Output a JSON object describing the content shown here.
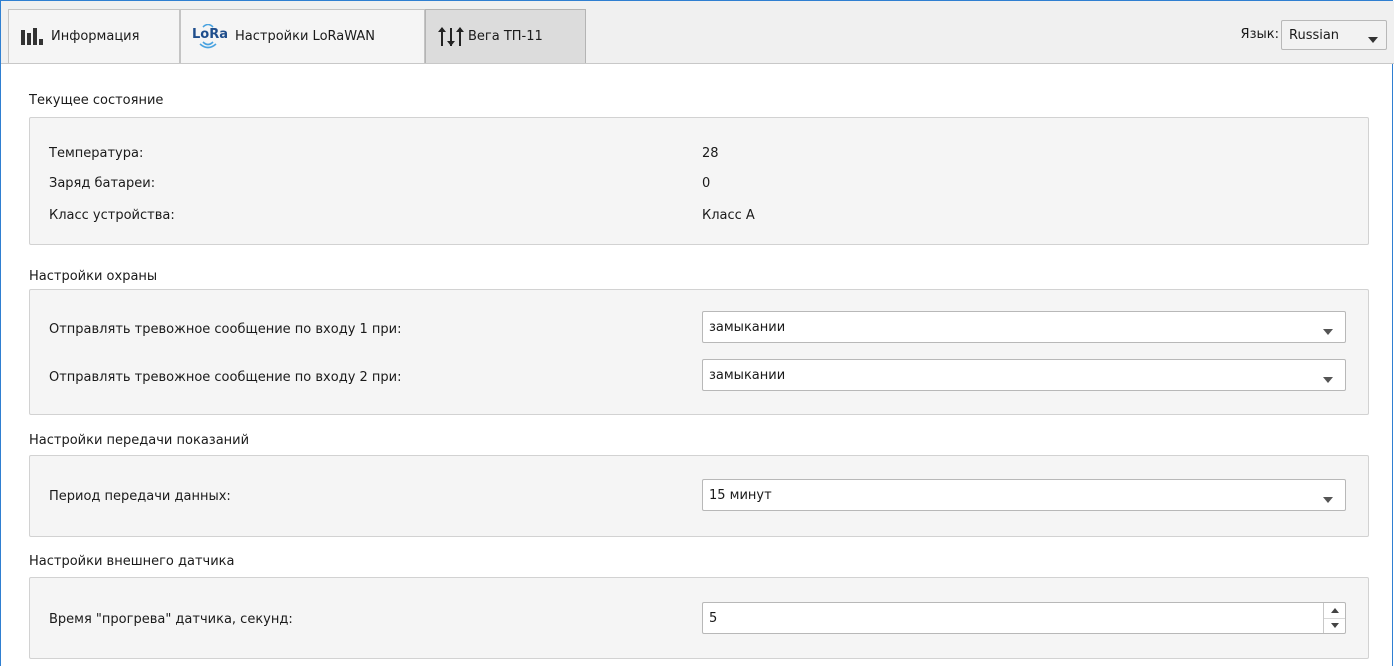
{
  "tabs": [
    {
      "label": "Информация",
      "icon": "bar-chart-icon",
      "active": false
    },
    {
      "label": "Настройки LoRaWAN",
      "icon": "lora-icon",
      "logo_text": "LoRa",
      "active": false
    },
    {
      "label": "Вега ТП-11",
      "icon": "sliders-icon",
      "active": true
    }
  ],
  "language": {
    "label": "Язык:",
    "value": "Russian"
  },
  "current_state": {
    "title": "Текущее состояние",
    "rows": [
      {
        "label": "Температура:",
        "value": "28"
      },
      {
        "label": "Заряд батареи:",
        "value": "0"
      },
      {
        "label": "Класс устройства:",
        "value": "Класс А"
      }
    ]
  },
  "security": {
    "title": "Настройки охраны",
    "rows": [
      {
        "label": "Отправлять тревожное сообщение по входу 1 при:",
        "value": "замыкании"
      },
      {
        "label": "Отправлять тревожное сообщение по входу 2 при:",
        "value": "замыкании"
      }
    ]
  },
  "transmission": {
    "title": "Настройки передачи показаний",
    "rows": [
      {
        "label": "Период передачи данных:",
        "value": "15 минут"
      }
    ]
  },
  "external_sensor": {
    "title": "Настройки внешнего датчика",
    "rows": [
      {
        "label": "Время \"прогрева\" датчика, секунд:",
        "value": "5"
      }
    ]
  },
  "colors": {
    "accent_border": "#2f7fd1",
    "lora_blue": "#1f6fb5",
    "group_background": "#f5f5f5"
  }
}
